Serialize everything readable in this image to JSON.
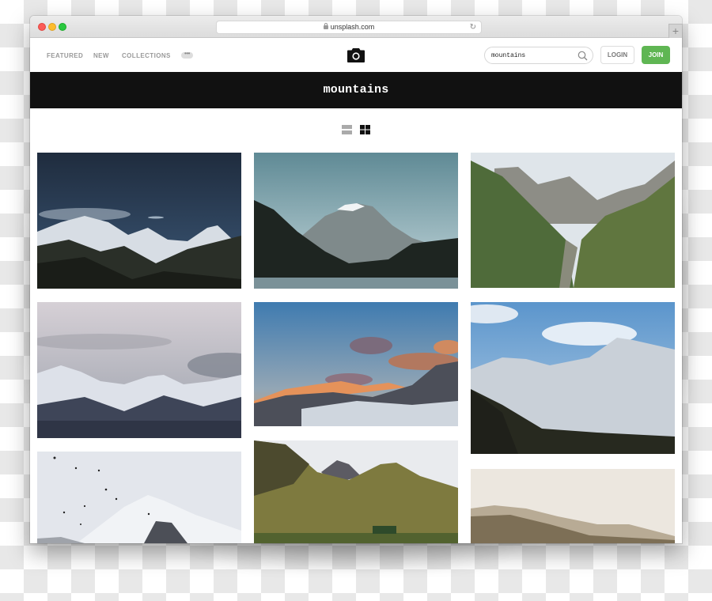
{
  "browser": {
    "url": "unsplash.com",
    "new_tab_label": "+"
  },
  "nav": {
    "links": [
      "FEATURED",
      "NEW",
      "COLLECTIONS"
    ],
    "more_label": "•••",
    "logo_icon": "camera-icon"
  },
  "search": {
    "value": "mountains",
    "icon": "search-icon"
  },
  "auth": {
    "login_label": "LOGIN",
    "join_label": "JOIN",
    "join_color": "#5fb653"
  },
  "banner": {
    "title": "mountains"
  },
  "view_toggle": {
    "options": [
      "list-view",
      "grid-view"
    ],
    "active": "grid-view"
  },
  "photos": [
    {
      "column": 1,
      "description": "Snowy peaks under night sky"
    },
    {
      "column": 2,
      "description": "Rocky mountain above lake"
    },
    {
      "column": 3,
      "description": "Green valley between mountains"
    },
    {
      "column": 1,
      "description": "Snowy peaks under cloudy sky"
    },
    {
      "column": 2,
      "description": "Sunset-lit peaks with clouds"
    },
    {
      "column": 3,
      "description": "Snowy ridge under blue sky"
    },
    {
      "column": 1,
      "description": "Birds over misty snowy peak"
    },
    {
      "column": 2,
      "description": "Green highland mountains with cottage"
    },
    {
      "column": 3,
      "description": "Snow-dusted forested hill"
    }
  ]
}
